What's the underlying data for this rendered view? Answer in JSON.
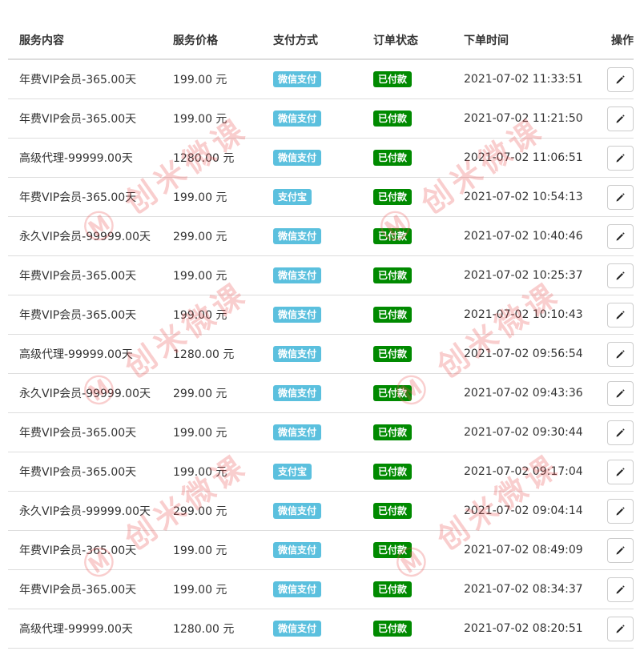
{
  "table": {
    "headers": [
      "服务内容",
      "服务价格",
      "支付方式",
      "订单状态",
      "下单时间",
      "操作"
    ],
    "rows": [
      {
        "service": "年费VIP会员-365.00天",
        "price": "199.00 元",
        "payment": "微信支付",
        "status": "已付款",
        "time": "2021-07-02 11:33:51"
      },
      {
        "service": "年费VIP会员-365.00天",
        "price": "199.00 元",
        "payment": "微信支付",
        "status": "已付款",
        "time": "2021-07-02 11:21:50"
      },
      {
        "service": "高级代理-99999.00天",
        "price": "1280.00 元",
        "payment": "微信支付",
        "status": "已付款",
        "time": "2021-07-02 11:06:51"
      },
      {
        "service": "年费VIP会员-365.00天",
        "price": "199.00 元",
        "payment": "支付宝",
        "status": "已付款",
        "time": "2021-07-02 10:54:13"
      },
      {
        "service": "永久VIP会员-99999.00天",
        "price": "299.00 元",
        "payment": "微信支付",
        "status": "已付款",
        "time": "2021-07-02 10:40:46"
      },
      {
        "service": "年费VIP会员-365.00天",
        "price": "199.00 元",
        "payment": "微信支付",
        "status": "已付款",
        "time": "2021-07-02 10:25:37"
      },
      {
        "service": "年费VIP会员-365.00天",
        "price": "199.00 元",
        "payment": "微信支付",
        "status": "已付款",
        "time": "2021-07-02 10:10:43"
      },
      {
        "service": "高级代理-99999.00天",
        "price": "1280.00 元",
        "payment": "微信支付",
        "status": "已付款",
        "time": "2021-07-02 09:56:54"
      },
      {
        "service": "永久VIP会员-99999.00天",
        "price": "299.00 元",
        "payment": "微信支付",
        "status": "已付款",
        "time": "2021-07-02 09:43:36"
      },
      {
        "service": "年费VIP会员-365.00天",
        "price": "199.00 元",
        "payment": "微信支付",
        "status": "已付款",
        "time": "2021-07-02 09:30:44"
      },
      {
        "service": "年费VIP会员-365.00天",
        "price": "199.00 元",
        "payment": "支付宝",
        "status": "已付款",
        "time": "2021-07-02 09:17:04"
      },
      {
        "service": "永久VIP会员-99999.00天",
        "price": "299.00 元",
        "payment": "微信支付",
        "status": "已付款",
        "time": "2021-07-02 09:04:14"
      },
      {
        "service": "年费VIP会员-365.00天",
        "price": "199.00 元",
        "payment": "微信支付",
        "status": "已付款",
        "time": "2021-07-02 08:49:09"
      },
      {
        "service": "年费VIP会员-365.00天",
        "price": "199.00 元",
        "payment": "微信支付",
        "status": "已付款",
        "time": "2021-07-02 08:34:37"
      },
      {
        "service": "高级代理-99999.00天",
        "price": "1280.00 元",
        "payment": "微信支付",
        "status": "已付款",
        "time": "2021-07-02 08:20:51"
      }
    ],
    "edit_icon": "pencil-icon"
  },
  "watermark": {
    "text": "创米微课"
  },
  "colors": {
    "payment_badge": "#5bc0de",
    "status_badge": "#008a00",
    "watermark": "#eb5050"
  }
}
